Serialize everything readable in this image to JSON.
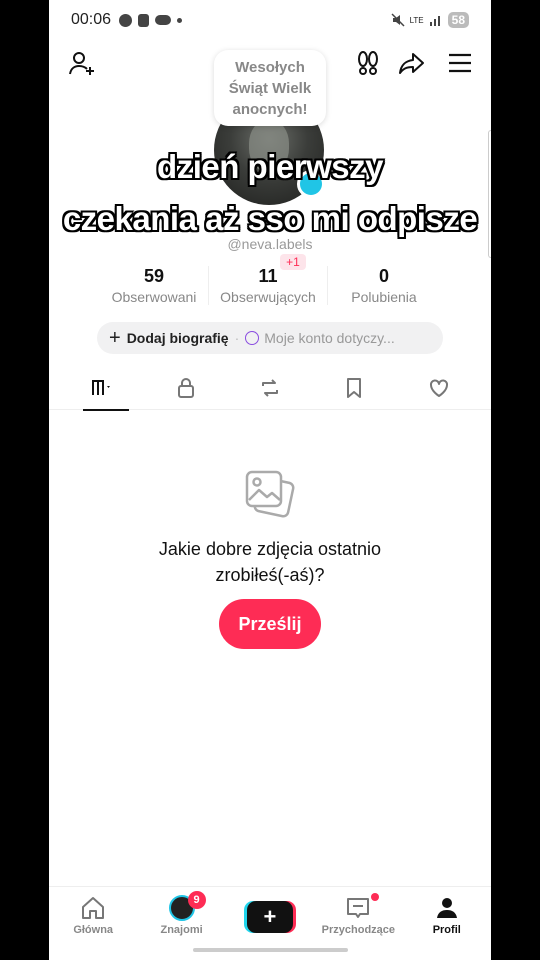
{
  "status_bar": {
    "time": "00:06",
    "network": "LTE",
    "battery": "58"
  },
  "greeting_bubble": "Wesołych Świąt Wielk anocnych!",
  "captions": [
    "dzień pierwszy",
    "czekania aż sso mi odpisze"
  ],
  "profile": {
    "username": "@neva.labels",
    "new_followers_badge": "+1"
  },
  "stats": [
    {
      "value": "59",
      "label": "Obserwowani"
    },
    {
      "value": "11",
      "label": "Obserwujących"
    },
    {
      "value": "0",
      "label": "Polubienia"
    }
  ],
  "bio": {
    "add_label": "Dodaj biografię",
    "separator": "·",
    "about_placeholder": "Moje konto dotyczy..."
  },
  "tabs": [
    "grid-icon",
    "lock-icon",
    "repost-icon",
    "bookmark-icon",
    "heart-icon"
  ],
  "empty_state": {
    "title": "Jakie dobre zdjęcia ostatnio zrobiłeś(-aś)?",
    "button": "Prześlij"
  },
  "bottom_nav": {
    "home": "Główna",
    "friends": "Znajomi",
    "friends_badge": "9",
    "create": "+",
    "inbox": "Przychodzące",
    "profile": "Profil"
  },
  "colors": {
    "accent": "#fe2c55",
    "teal": "#20c5e6",
    "text": "#111111",
    "muted": "#888888"
  }
}
